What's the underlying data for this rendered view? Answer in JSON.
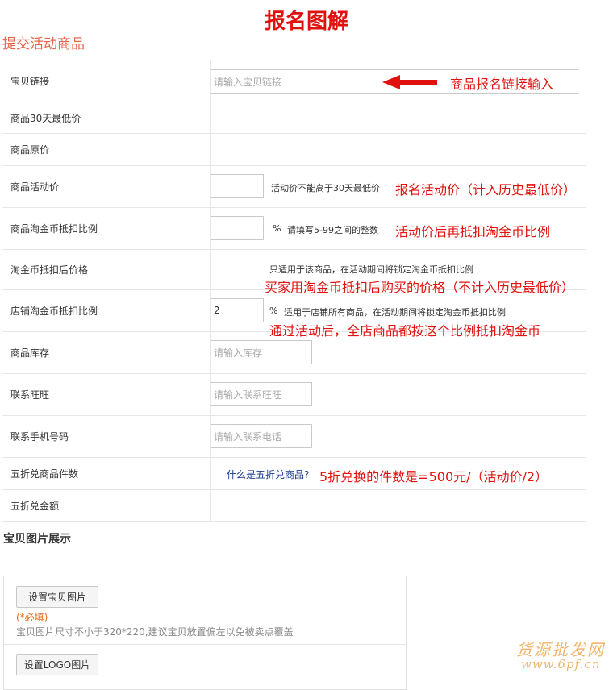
{
  "header": {
    "title": "报名图解",
    "section_title": "提交活动商品"
  },
  "form": {
    "link_label": "宝贝链接",
    "link_placeholder": "请输入宝贝链接",
    "lowest30_label": "商品30天最低价",
    "original_label": "商品原价",
    "activity_price_label": "商品活动价",
    "activity_price_note": "活动价不能高于30天最低价",
    "coin_ratio_label": "商品淘金币抵扣比例",
    "coin_ratio_unit": "%",
    "coin_ratio_note": "请填写5-99之间的整数",
    "after_coin_label": "淘金币抵扣后价格",
    "after_coin_note": "只适用于该商品，在活动期间将锁定淘金币抵扣比例",
    "shop_ratio_label": "店铺淘金币抵扣比例",
    "shop_ratio_value": "2",
    "shop_ratio_unit": "%",
    "shop_ratio_note": "适用于店铺所有商品，在活动期间将锁定淘金币抵扣比例",
    "stock_label": "商品库存",
    "stock_placeholder": "请输入库存",
    "wangwang_label": "联系旺旺",
    "wangwang_placeholder": "请输入联系旺旺",
    "phone_label": "联系手机号码",
    "phone_placeholder": "请输入联系电话",
    "half_count_label": "五折兑商品件数",
    "half_link": "什么是五折兑商品?",
    "half_amount_label": "五折兑金额"
  },
  "annotations": {
    "link": "商品报名链接输入",
    "activity_price": "报名活动价（计入历史最低价）",
    "coin_ratio": "活动价后再抵扣淘金币比例",
    "after_coin": "买家用淘金币抵扣后购买的价格（不计入历史最低价）",
    "shop_ratio": "通过活动后，全店商品都按这个比例抵扣淘金币",
    "half_count": "5折兑换的件数是=500元/（活动价/2）"
  },
  "images_section": {
    "title": "宝贝图片展示",
    "set_image_button": "设置宝贝图片",
    "required": "(*必填)",
    "image_hint": "宝贝图片尺寸不小于320*220,建议宝贝放置偏左以免被卖点覆盖",
    "set_logo_button": "设置LOGO图片"
  },
  "watermark": {
    "line1": "货源批发网",
    "line2": "www.6pf.cn"
  },
  "colors": {
    "annotation_red": "#e0120f",
    "section_orange": "#e8664c",
    "link_blue": "#1a3d8f"
  }
}
